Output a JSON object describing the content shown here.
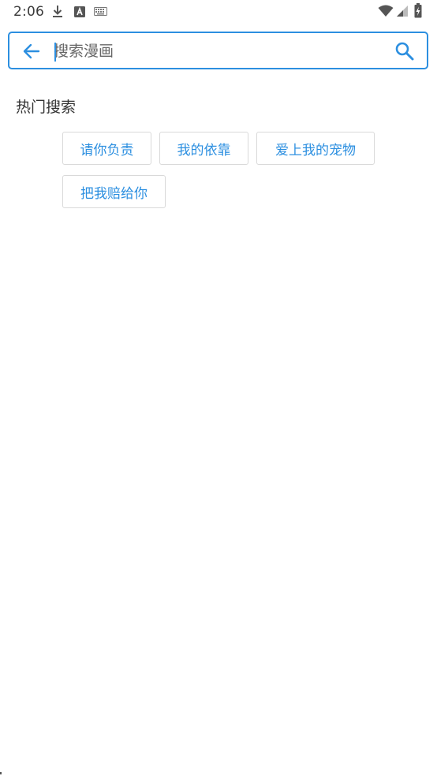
{
  "status_bar": {
    "time": "2:06",
    "icons": [
      "download-icon",
      "a-notification-icon",
      "keyboard-icon",
      "wifi-icon",
      "signal-icon",
      "battery-charging-icon"
    ]
  },
  "search": {
    "placeholder": "搜索漫画",
    "value": "",
    "accent_color": "#2c8fe0"
  },
  "hot_search": {
    "title": "热门搜索",
    "tags": [
      "请你负责",
      "我的依靠",
      "爱上我的宠物",
      "把我赔给你"
    ]
  }
}
